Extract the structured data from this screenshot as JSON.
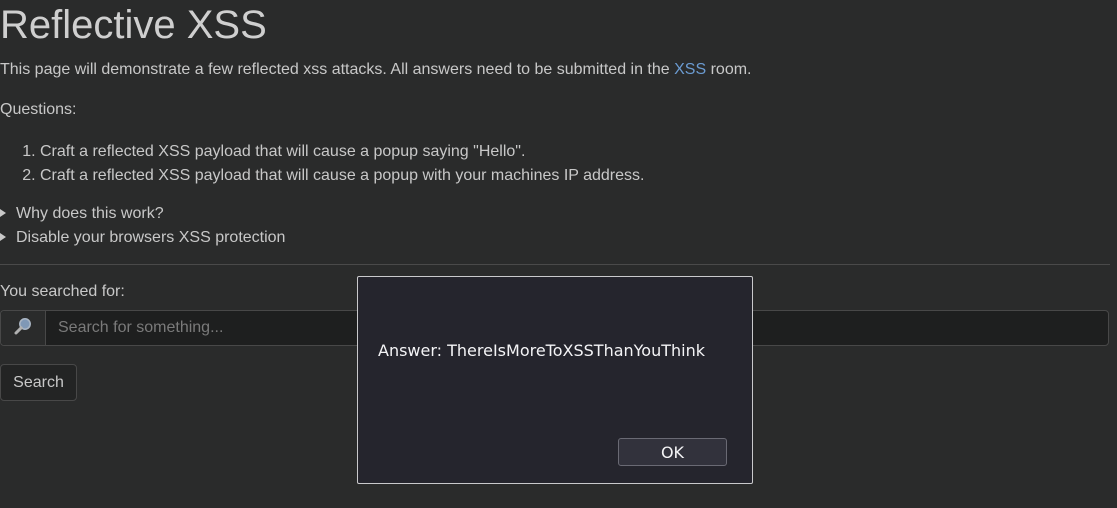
{
  "page": {
    "title": "Reflective XSS",
    "intro_prefix": "This page will demonstrate a few reflected xss attacks. All answers need to be submitted in the ",
    "intro_link": "XSS",
    "intro_suffix": " room.",
    "questions_label": "Questions:",
    "questions": [
      "Craft a reflected XSS payload that will cause a popup saying \"Hello\".",
      "Craft a reflected XSS payload that will cause a popup with your machines IP address."
    ],
    "details": [
      "Why does this work?",
      "Disable your browsers XSS protection"
    ],
    "searched_for_label": "You searched for:"
  },
  "search": {
    "icon": "magnifier-icon",
    "placeholder": "Search for something...",
    "value": "",
    "button_label": "Search"
  },
  "dialog": {
    "message": "Answer: ThereIsMoreToXSSThanYouThink",
    "ok_label": "OK"
  },
  "colors": {
    "background": "#2a2b2b",
    "text": "#c8c8c8",
    "link": "#6b9bd1",
    "dialog_bg": "#25252d",
    "dialog_border": "#c9c9cc"
  }
}
